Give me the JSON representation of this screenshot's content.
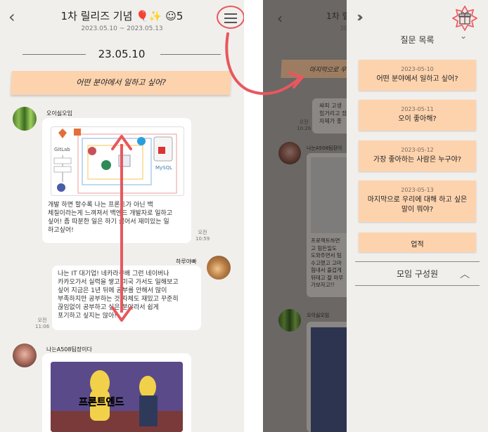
{
  "chat": {
    "title": "1차 릴리즈 기념 🎈✨ ☺5",
    "date_range": "2023.05.10 ~ 2023.05.13",
    "date_divider": "23.05.10",
    "question": "어떤 분야에서 일하고 싶어?",
    "messages": [
      {
        "user": "오이싫오임",
        "image": "GitLab / Jenkins / MySQL architecture diagram",
        "text": "개발 하면 할수록 나는 프론트가 아닌 백\n체질이라는게 느껴져서 백엔드 개발자로 일하고\n싶어! 좀 따분한 일은 하기 싫어서 재미있는 일\n하고싶어!",
        "time_ampm": "오전",
        "time": "10:59"
      },
      {
        "user": "하루야빠",
        "text": "나는 IT 대기업! 네카라쿠배 그런 네이버나\n카카오가서 실력을 쌓고 미국 가서도 일해보고\n싶어 지금은 1년 뒤에 공부를 안해서 많이\n부족하지만 공부하는 것 자체도 재밌고 꾸준히\n끊임없이 공부하고 싶은 분야라서 쉽게\n포기하고 싶지는 않아!",
        "time_ampm": "오전",
        "time": "11:06"
      },
      {
        "user": "나는A508팀장이다",
        "image_caption": "프론트엔드"
      }
    ],
    "diagram_labels": {
      "gitlab": "GitLab",
      "mysql": "MySQL"
    }
  },
  "background_chat": {
    "banner": "마지막으로 우",
    "lines": [
      "싸피 고생",
      "힘거리고 잤",
      "자체가 좋"
    ],
    "time_ampm": "오전",
    "time": "10:26",
    "user2": "나는A508팀장이",
    "text2": "프로젝트하면\n고 힘든일도\n도와주면서 팀\n수고했고 고마\n힘내서 즐겁게\n뒤테고 잘 마무\n가보자고!!",
    "user3": "오이싫오임"
  },
  "drawer": {
    "section_title": "질문 목록",
    "questions": [
      {
        "date": "2023-05-10",
        "text": "어떤 분야에서 일하고 싶어?"
      },
      {
        "date": "2023-05-11",
        "text": "오이 좋아해?"
      },
      {
        "date": "2023-05-12",
        "text": "가장 좋아하는 사람은 누구야?"
      },
      {
        "date": "2023-05-13",
        "text": "마지막으로 우리에 대해 하고 싶은 말이 뭐야?"
      }
    ],
    "achievement_label": "업적",
    "members_label": "모임 구성원"
  },
  "icons": [
    "back-icon",
    "menu-icon",
    "double-chevron-right-icon",
    "gift-icon",
    "chevron-down-icon",
    "chevron-up-icon"
  ],
  "colors": {
    "banner": "#fdd3ae",
    "annotation": "#e8575e",
    "background": "#f1efec"
  }
}
